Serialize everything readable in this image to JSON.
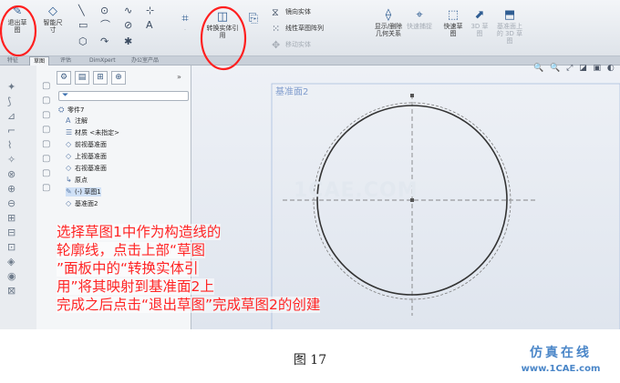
{
  "ribbon": {
    "exit_sketch": "退出草图",
    "smart_dimension": "智能尺寸",
    "convert_entities": "转换实体引用",
    "mirror_entities": "镜向实体",
    "linear_pattern": "线性草图阵列",
    "move_entities": "移动实体",
    "display_relations": "显示/删除几何关系",
    "quick_snaps": "快速捕捉",
    "quick_sketch": "快速草图",
    "sketch_3d": "3D 草图",
    "sketch_3d_on_plane": "基准面上的 3D 草图"
  },
  "tabs": [
    {
      "label": "特征"
    },
    {
      "label": "草图"
    },
    {
      "label": "评估"
    },
    {
      "label": "DimXpert"
    },
    {
      "label": "办公室产品"
    }
  ],
  "feature_tree": {
    "root": "零件7",
    "items": [
      {
        "label": "注解"
      },
      {
        "label": "材质 <未指定>"
      },
      {
        "label": "前视基准面"
      },
      {
        "label": "上视基准面"
      },
      {
        "label": "右视基准面"
      },
      {
        "label": "原点"
      },
      {
        "label": "(-) 草图1"
      },
      {
        "label": "基准面2"
      }
    ]
  },
  "graphics": {
    "plane_label": "基准面2",
    "watermark": "1CAE.COM"
  },
  "annotation": {
    "lines": [
      "选择草图1中作为构造线的",
      "轮廓线，点击上部“草图",
      "”面板中的“转换实体引",
      "用”将其映射到基准面2上",
      "完成之后点击“退出草图”完成草图2的创建"
    ]
  },
  "caption": "图 17",
  "footer": {
    "brand": "仿真在线",
    "site": "www.1CAE.com"
  },
  "colors": {
    "annotation_red": "#ff2424",
    "circle_stroke": "#333333",
    "plane_label": "#7f9ccd",
    "brand_blue": "#4a86c8"
  }
}
